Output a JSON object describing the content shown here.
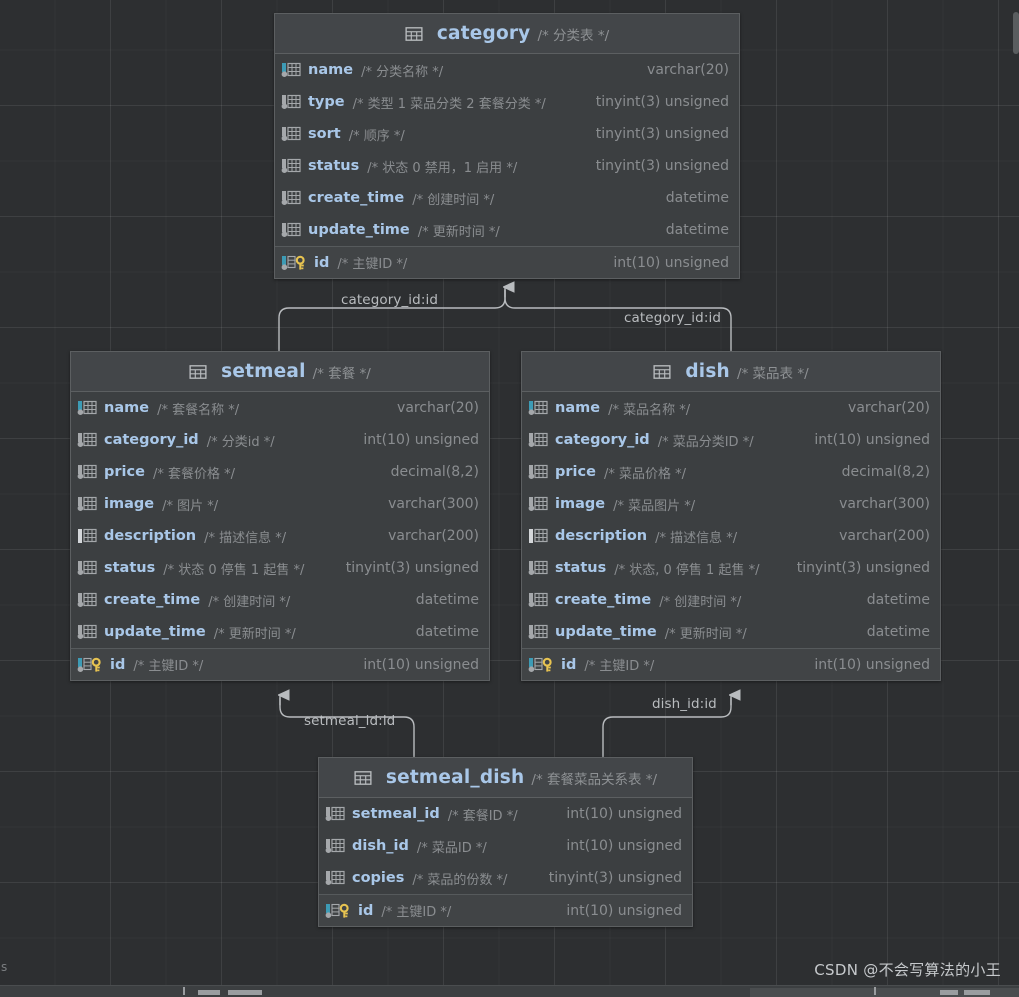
{
  "diagram": {
    "kind": "database-er-diagram",
    "watermark": "CSDN @不会写算法的小王",
    "corner_letter": "s",
    "colors": {
      "canvas_background": "#2d2f31",
      "table_background": "#3c3f41",
      "table_header_background": "#434649",
      "table_border": "#5c5f61",
      "column_name": "#a9c7e8",
      "column_type": "#8a8d90",
      "comment": "#8a8d90",
      "connector": "#b9bcbf",
      "key_icon": "#e8c451",
      "accent_cyan": "#3d9bb5"
    }
  },
  "tables": [
    {
      "id": "category",
      "name": "category",
      "comment": "/* 分类表 */",
      "icon": "table-grid-icon",
      "columns": [
        {
          "name": "name",
          "comment": "/* 分类名称 */",
          "type": "varchar(20)",
          "icon": "column-icon",
          "marker": "cyan",
          "pk": false
        },
        {
          "name": "type",
          "comment": "/* 类型 1 菜品分类 2 套餐分类 */",
          "type": "tinyint(3) unsigned",
          "icon": "column-icon",
          "marker": "gray",
          "pk": false
        },
        {
          "name": "sort",
          "comment": "/* 顺序 */",
          "type": "tinyint(3) unsigned",
          "icon": "column-icon",
          "marker": "gray",
          "pk": false
        },
        {
          "name": "status",
          "comment": "/* 状态 0 禁用，1 启用 */",
          "type": "tinyint(3) unsigned",
          "icon": "column-icon",
          "marker": "gray",
          "pk": false
        },
        {
          "name": "create_time",
          "comment": "/* 创建时间 */",
          "type": "datetime",
          "icon": "column-icon",
          "marker": "gray",
          "pk": false
        },
        {
          "name": "update_time",
          "comment": "/* 更新时间 */",
          "type": "datetime",
          "icon": "column-icon",
          "marker": "gray",
          "pk": false
        },
        {
          "name": "id",
          "comment": "/* 主键ID */",
          "type": "int(10) unsigned",
          "icon": "primary-key-icon",
          "marker": "cyan",
          "pk": true
        }
      ]
    },
    {
      "id": "setmeal",
      "name": "setmeal",
      "comment": "/* 套餐 */",
      "icon": "table-grid-icon",
      "columns": [
        {
          "name": "name",
          "comment": "/* 套餐名称 */",
          "type": "varchar(20)",
          "icon": "column-icon",
          "marker": "cyan",
          "pk": false
        },
        {
          "name": "category_id",
          "comment": "/* 分类id */",
          "type": "int(10) unsigned",
          "icon": "column-icon",
          "marker": "gray",
          "pk": false
        },
        {
          "name": "price",
          "comment": "/* 套餐价格 */",
          "type": "decimal(8,2)",
          "icon": "column-icon",
          "marker": "gray",
          "pk": false
        },
        {
          "name": "image",
          "comment": "/* 图片 */",
          "type": "varchar(300)",
          "icon": "column-icon",
          "marker": "gray",
          "pk": false
        },
        {
          "name": "description",
          "comment": "/* 描述信息 */",
          "type": "varchar(200)",
          "icon": "column-icon",
          "marker": "light",
          "pk": false
        },
        {
          "name": "status",
          "comment": "/* 状态 0 停售 1 起售 */",
          "type": "tinyint(3) unsigned",
          "icon": "column-icon",
          "marker": "gray",
          "pk": false
        },
        {
          "name": "create_time",
          "comment": "/* 创建时间 */",
          "type": "datetime",
          "icon": "column-icon",
          "marker": "gray",
          "pk": false
        },
        {
          "name": "update_time",
          "comment": "/* 更新时间 */",
          "type": "datetime",
          "icon": "column-icon",
          "marker": "gray",
          "pk": false
        },
        {
          "name": "id",
          "comment": "/* 主键ID */",
          "type": "int(10) unsigned",
          "icon": "primary-key-icon",
          "marker": "cyan",
          "pk": true
        }
      ]
    },
    {
      "id": "dish",
      "name": "dish",
      "comment": "/* 菜品表 */",
      "icon": "table-grid-icon",
      "columns": [
        {
          "name": "name",
          "comment": "/* 菜品名称 */",
          "type": "varchar(20)",
          "icon": "column-icon",
          "marker": "cyan",
          "pk": false
        },
        {
          "name": "category_id",
          "comment": "/* 菜品分类ID */",
          "type": "int(10) unsigned",
          "icon": "column-icon",
          "marker": "gray",
          "pk": false
        },
        {
          "name": "price",
          "comment": "/* 菜品价格 */",
          "type": "decimal(8,2)",
          "icon": "column-icon",
          "marker": "gray",
          "pk": false
        },
        {
          "name": "image",
          "comment": "/* 菜品图片 */",
          "type": "varchar(300)",
          "icon": "column-icon",
          "marker": "gray",
          "pk": false
        },
        {
          "name": "description",
          "comment": "/* 描述信息 */",
          "type": "varchar(200)",
          "icon": "column-icon",
          "marker": "light",
          "pk": false
        },
        {
          "name": "status",
          "comment": "/* 状态, 0 停售 1 起售 */",
          "type": "tinyint(3) unsigned",
          "icon": "column-icon",
          "marker": "gray",
          "pk": false
        },
        {
          "name": "create_time",
          "comment": "/* 创建时间 */",
          "type": "datetime",
          "icon": "column-icon",
          "marker": "gray",
          "pk": false
        },
        {
          "name": "update_time",
          "comment": "/* 更新时间 */",
          "type": "datetime",
          "icon": "column-icon",
          "marker": "gray",
          "pk": false
        },
        {
          "name": "id",
          "comment": "/* 主键ID */",
          "type": "int(10) unsigned",
          "icon": "primary-key-icon",
          "marker": "cyan",
          "pk": true
        }
      ]
    },
    {
      "id": "setmeal_dish",
      "name": "setmeal_dish",
      "comment": "/* 套餐菜品关系表 */",
      "icon": "table-grid-icon",
      "columns": [
        {
          "name": "setmeal_id",
          "comment": "/* 套餐ID */",
          "type": "int(10) unsigned",
          "icon": "column-icon",
          "marker": "gray",
          "pk": false
        },
        {
          "name": "dish_id",
          "comment": "/* 菜品ID */",
          "type": "int(10) unsigned",
          "icon": "column-icon",
          "marker": "gray",
          "pk": false
        },
        {
          "name": "copies",
          "comment": "/* 菜品的份数 */",
          "type": "tinyint(3) unsigned",
          "icon": "column-icon",
          "marker": "gray",
          "pk": false
        },
        {
          "name": "id",
          "comment": "/* 主键ID */",
          "type": "int(10) unsigned",
          "icon": "primary-key-icon",
          "marker": "cyan",
          "pk": true
        }
      ]
    }
  ],
  "relationships": [
    {
      "id": "setmeal-category",
      "label": "category_id:id",
      "from": "setmeal",
      "to": "category"
    },
    {
      "id": "dish-category",
      "label": "category_id:id",
      "from": "dish",
      "to": "category"
    },
    {
      "id": "setmeal_dish-setmeal",
      "label": "setmeal_id:id",
      "from": "setmeal_dish",
      "to": "setmeal"
    },
    {
      "id": "setmeal_dish-dish",
      "label": "dish_id:id",
      "from": "setmeal_dish",
      "to": "dish"
    }
  ]
}
